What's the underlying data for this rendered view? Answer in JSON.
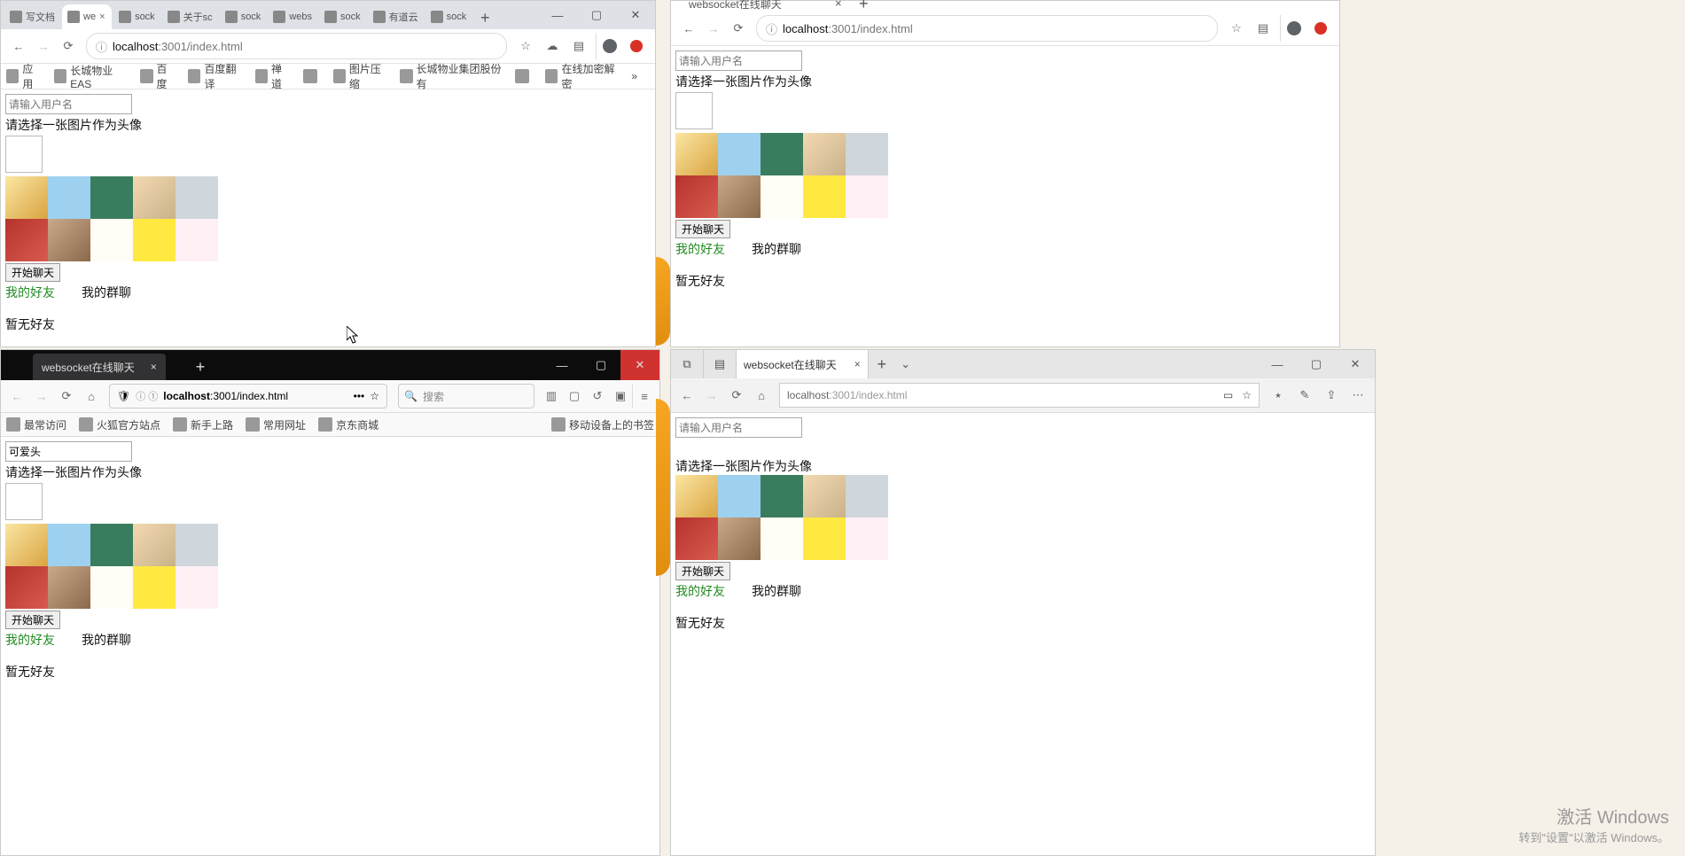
{
  "common_page": {
    "username_placeholder": "请输入用户名",
    "choose_avatar_label": "请选择一张图片作为头像",
    "start_chat_label": "开始聊天",
    "tab_friends": "我的好友",
    "tab_groups": "我的群聊",
    "no_friends": "暂无好友"
  },
  "chrome1": {
    "tabs": [
      "写文档",
      "we",
      "sock",
      "关于sc",
      "sock",
      "webs",
      "sock",
      "有道云",
      "sock"
    ],
    "active_tab_index": 1,
    "url_host": "localhost",
    "url_port": ":3001",
    "url_path": "/index.html",
    "bookmarks": [
      "应用",
      "长城物业EAS",
      "百度",
      "百度翻译",
      "禅道",
      "",
      "图片压缩",
      "长城物业集团股份有",
      "",
      "在线加密解密"
    ],
    "username_value": ""
  },
  "chrome2": {
    "tab_title": "websocket在线聊天",
    "url_host": "localhost",
    "url_port": ":3001",
    "url_path": "/index.html",
    "username_value": ""
  },
  "firefox": {
    "tab_title": "websocket在线聊天",
    "url_host": "localhost",
    "url_hint": "ⓘ ①",
    "url_port": ":3001",
    "url_path": "/index.html",
    "search_placeholder": "搜索",
    "bookmarks_left": [
      "最常访问",
      "火狐官方站点",
      "新手上路",
      "常用网址",
      "京东商城"
    ],
    "bookmarks_right": "移动设备上的书签",
    "username_value": "可爱头"
  },
  "edge": {
    "tab_title": "websocket在线聊天",
    "url_host": "localhost",
    "url_port": ":3001",
    "url_path": "/index.html",
    "username_value": ""
  },
  "watermark": {
    "line1": "激活 Windows",
    "line2": "转到\"设置\"以激活 Windows。"
  },
  "avatar_classes": [
    "c0",
    "c1",
    "c2",
    "c3",
    "c4",
    "c5",
    "c6",
    "c7",
    "c8",
    "c9"
  ]
}
